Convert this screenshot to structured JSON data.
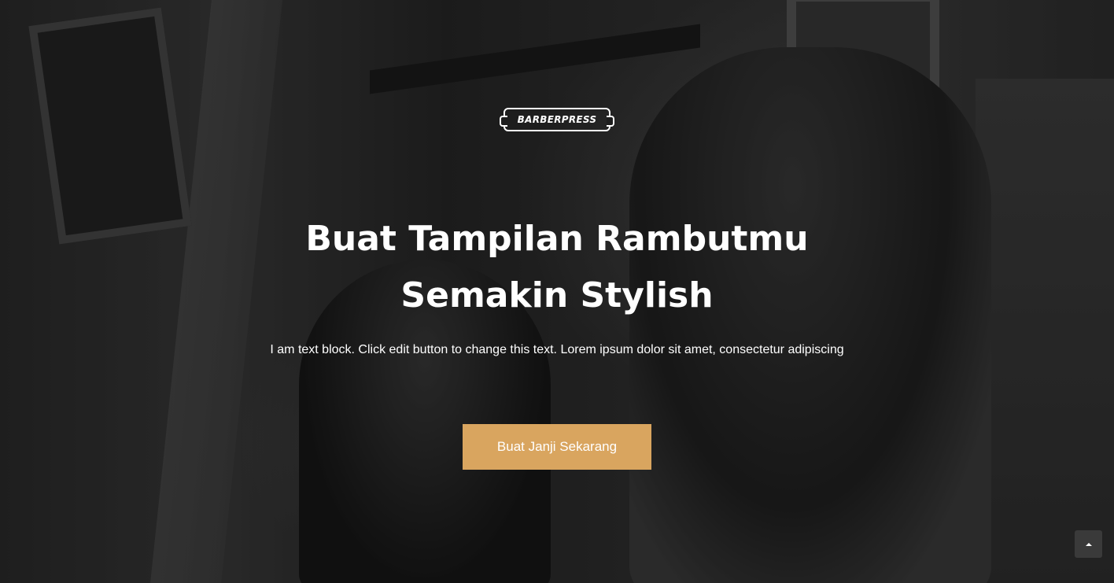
{
  "logo": {
    "text": "BARBERPRESS"
  },
  "hero": {
    "headline_line1": "Buat Tampilan Rambutmu",
    "headline_line2": "Semakin Stylish",
    "subtext": "I am text block. Click edit button to change this text. Lorem ipsum dolor sit amet, consectetur adipiscing",
    "cta_label": "Buat Janji Sekarang"
  },
  "scroll_top": {
    "icon": "chevron-up-icon"
  },
  "colors": {
    "accent": "#d9a55f",
    "text": "#ffffff",
    "scroll_button_bg": "#3a3a3a"
  }
}
